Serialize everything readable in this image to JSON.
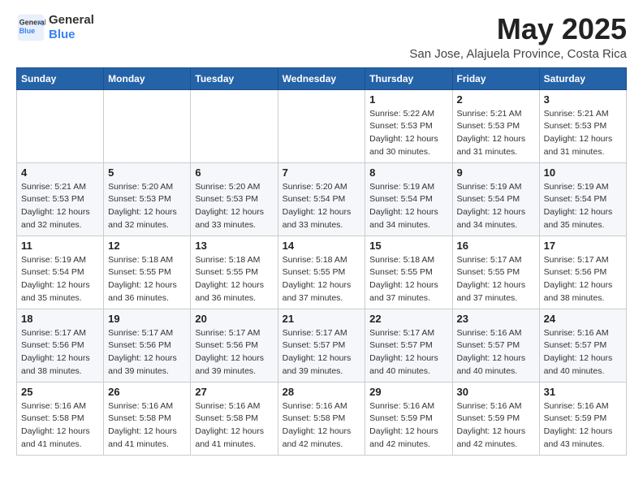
{
  "logo": {
    "line1": "General",
    "line2": "Blue"
  },
  "title": "May 2025",
  "subtitle": "San Jose, Alajuela Province, Costa Rica",
  "weekdays": [
    "Sunday",
    "Monday",
    "Tuesday",
    "Wednesday",
    "Thursday",
    "Friday",
    "Saturday"
  ],
  "weeks": [
    [
      {
        "day": "",
        "info": ""
      },
      {
        "day": "",
        "info": ""
      },
      {
        "day": "",
        "info": ""
      },
      {
        "day": "",
        "info": ""
      },
      {
        "day": "1",
        "info": "Sunrise: 5:22 AM\nSunset: 5:53 PM\nDaylight: 12 hours and 30 minutes."
      },
      {
        "day": "2",
        "info": "Sunrise: 5:21 AM\nSunset: 5:53 PM\nDaylight: 12 hours and 31 minutes."
      },
      {
        "day": "3",
        "info": "Sunrise: 5:21 AM\nSunset: 5:53 PM\nDaylight: 12 hours and 31 minutes."
      }
    ],
    [
      {
        "day": "4",
        "info": "Sunrise: 5:21 AM\nSunset: 5:53 PM\nDaylight: 12 hours and 32 minutes."
      },
      {
        "day": "5",
        "info": "Sunrise: 5:20 AM\nSunset: 5:53 PM\nDaylight: 12 hours and 32 minutes."
      },
      {
        "day": "6",
        "info": "Sunrise: 5:20 AM\nSunset: 5:53 PM\nDaylight: 12 hours and 33 minutes."
      },
      {
        "day": "7",
        "info": "Sunrise: 5:20 AM\nSunset: 5:54 PM\nDaylight: 12 hours and 33 minutes."
      },
      {
        "day": "8",
        "info": "Sunrise: 5:19 AM\nSunset: 5:54 PM\nDaylight: 12 hours and 34 minutes."
      },
      {
        "day": "9",
        "info": "Sunrise: 5:19 AM\nSunset: 5:54 PM\nDaylight: 12 hours and 34 minutes."
      },
      {
        "day": "10",
        "info": "Sunrise: 5:19 AM\nSunset: 5:54 PM\nDaylight: 12 hours and 35 minutes."
      }
    ],
    [
      {
        "day": "11",
        "info": "Sunrise: 5:19 AM\nSunset: 5:54 PM\nDaylight: 12 hours and 35 minutes."
      },
      {
        "day": "12",
        "info": "Sunrise: 5:18 AM\nSunset: 5:55 PM\nDaylight: 12 hours and 36 minutes."
      },
      {
        "day": "13",
        "info": "Sunrise: 5:18 AM\nSunset: 5:55 PM\nDaylight: 12 hours and 36 minutes."
      },
      {
        "day": "14",
        "info": "Sunrise: 5:18 AM\nSunset: 5:55 PM\nDaylight: 12 hours and 37 minutes."
      },
      {
        "day": "15",
        "info": "Sunrise: 5:18 AM\nSunset: 5:55 PM\nDaylight: 12 hours and 37 minutes."
      },
      {
        "day": "16",
        "info": "Sunrise: 5:17 AM\nSunset: 5:55 PM\nDaylight: 12 hours and 37 minutes."
      },
      {
        "day": "17",
        "info": "Sunrise: 5:17 AM\nSunset: 5:56 PM\nDaylight: 12 hours and 38 minutes."
      }
    ],
    [
      {
        "day": "18",
        "info": "Sunrise: 5:17 AM\nSunset: 5:56 PM\nDaylight: 12 hours and 38 minutes."
      },
      {
        "day": "19",
        "info": "Sunrise: 5:17 AM\nSunset: 5:56 PM\nDaylight: 12 hours and 39 minutes."
      },
      {
        "day": "20",
        "info": "Sunrise: 5:17 AM\nSunset: 5:56 PM\nDaylight: 12 hours and 39 minutes."
      },
      {
        "day": "21",
        "info": "Sunrise: 5:17 AM\nSunset: 5:57 PM\nDaylight: 12 hours and 39 minutes."
      },
      {
        "day": "22",
        "info": "Sunrise: 5:17 AM\nSunset: 5:57 PM\nDaylight: 12 hours and 40 minutes."
      },
      {
        "day": "23",
        "info": "Sunrise: 5:16 AM\nSunset: 5:57 PM\nDaylight: 12 hours and 40 minutes."
      },
      {
        "day": "24",
        "info": "Sunrise: 5:16 AM\nSunset: 5:57 PM\nDaylight: 12 hours and 40 minutes."
      }
    ],
    [
      {
        "day": "25",
        "info": "Sunrise: 5:16 AM\nSunset: 5:58 PM\nDaylight: 12 hours and 41 minutes."
      },
      {
        "day": "26",
        "info": "Sunrise: 5:16 AM\nSunset: 5:58 PM\nDaylight: 12 hours and 41 minutes."
      },
      {
        "day": "27",
        "info": "Sunrise: 5:16 AM\nSunset: 5:58 PM\nDaylight: 12 hours and 41 minutes."
      },
      {
        "day": "28",
        "info": "Sunrise: 5:16 AM\nSunset: 5:58 PM\nDaylight: 12 hours and 42 minutes."
      },
      {
        "day": "29",
        "info": "Sunrise: 5:16 AM\nSunset: 5:59 PM\nDaylight: 12 hours and 42 minutes."
      },
      {
        "day": "30",
        "info": "Sunrise: 5:16 AM\nSunset: 5:59 PM\nDaylight: 12 hours and 42 minutes."
      },
      {
        "day": "31",
        "info": "Sunrise: 5:16 AM\nSunset: 5:59 PM\nDaylight: 12 hours and 43 minutes."
      }
    ]
  ]
}
